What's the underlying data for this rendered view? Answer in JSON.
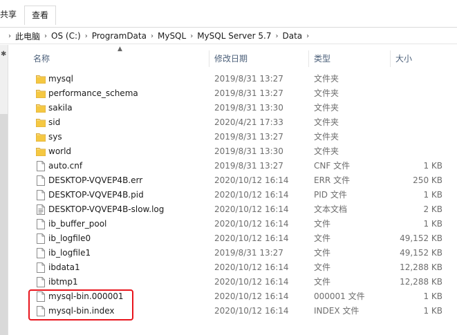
{
  "ribbon": {
    "tab_share": "共享",
    "tab_view": "查看"
  },
  "address": {
    "crumbs": [
      "此电脑",
      "OS (C:)",
      "ProgramData",
      "MySQL",
      "MySQL Server 5.7",
      "Data"
    ]
  },
  "columns": {
    "name": "名称",
    "date": "修改日期",
    "type": "类型",
    "size": "大小"
  },
  "files": [
    {
      "name": "mysql",
      "date": "2019/8/31 13:27",
      "type": "文件夹",
      "size": "",
      "icon": "folder-icon"
    },
    {
      "name": "performance_schema",
      "date": "2019/8/31 13:27",
      "type": "文件夹",
      "size": "",
      "icon": "folder-icon"
    },
    {
      "name": "sakila",
      "date": "2019/8/31 13:30",
      "type": "文件夹",
      "size": "",
      "icon": "folder-icon"
    },
    {
      "name": "sid",
      "date": "2020/4/21 17:33",
      "type": "文件夹",
      "size": "",
      "icon": "folder-icon"
    },
    {
      "name": "sys",
      "date": "2019/8/31 13:27",
      "type": "文件夹",
      "size": "",
      "icon": "folder-icon"
    },
    {
      "name": "world",
      "date": "2019/8/31 13:30",
      "type": "文件夹",
      "size": "",
      "icon": "folder-icon"
    },
    {
      "name": "auto.cnf",
      "date": "2019/8/31 13:27",
      "type": "CNF 文件",
      "size": "1 KB",
      "icon": "file-icon"
    },
    {
      "name": "DESKTOP-VQVEP4B.err",
      "date": "2020/10/12 16:14",
      "type": "ERR 文件",
      "size": "250 KB",
      "icon": "file-icon"
    },
    {
      "name": "DESKTOP-VQVEP4B.pid",
      "date": "2020/10/12 16:14",
      "type": "PID 文件",
      "size": "1 KB",
      "icon": "file-icon"
    },
    {
      "name": "DESKTOP-VQVEP4B-slow.log",
      "date": "2020/10/12 16:14",
      "type": "文本文档",
      "size": "2 KB",
      "icon": "text-file-icon"
    },
    {
      "name": "ib_buffer_pool",
      "date": "2020/10/12 16:14",
      "type": "文件",
      "size": "1 KB",
      "icon": "file-icon"
    },
    {
      "name": "ib_logfile0",
      "date": "2020/10/12 16:14",
      "type": "文件",
      "size": "49,152 KB",
      "icon": "file-icon"
    },
    {
      "name": "ib_logfile1",
      "date": "2019/8/31 13:27",
      "type": "文件",
      "size": "49,152 KB",
      "icon": "file-icon"
    },
    {
      "name": "ibdata1",
      "date": "2020/10/12 16:14",
      "type": "文件",
      "size": "12,288 KB",
      "icon": "file-icon"
    },
    {
      "name": "ibtmp1",
      "date": "2020/10/12 16:14",
      "type": "文件",
      "size": "12,288 KB",
      "icon": "file-icon"
    },
    {
      "name": "mysql-bin.000001",
      "date": "2020/10/12 16:14",
      "type": "000001 文件",
      "size": "1 KB",
      "icon": "file-icon"
    },
    {
      "name": "mysql-bin.index",
      "date": "2020/10/12 16:14",
      "type": "INDEX 文件",
      "size": "1 KB",
      "icon": "file-icon"
    }
  ],
  "colors": {
    "highlight": "#e8141c",
    "folder": "#f5c842",
    "header_text": "#4c607a"
  }
}
